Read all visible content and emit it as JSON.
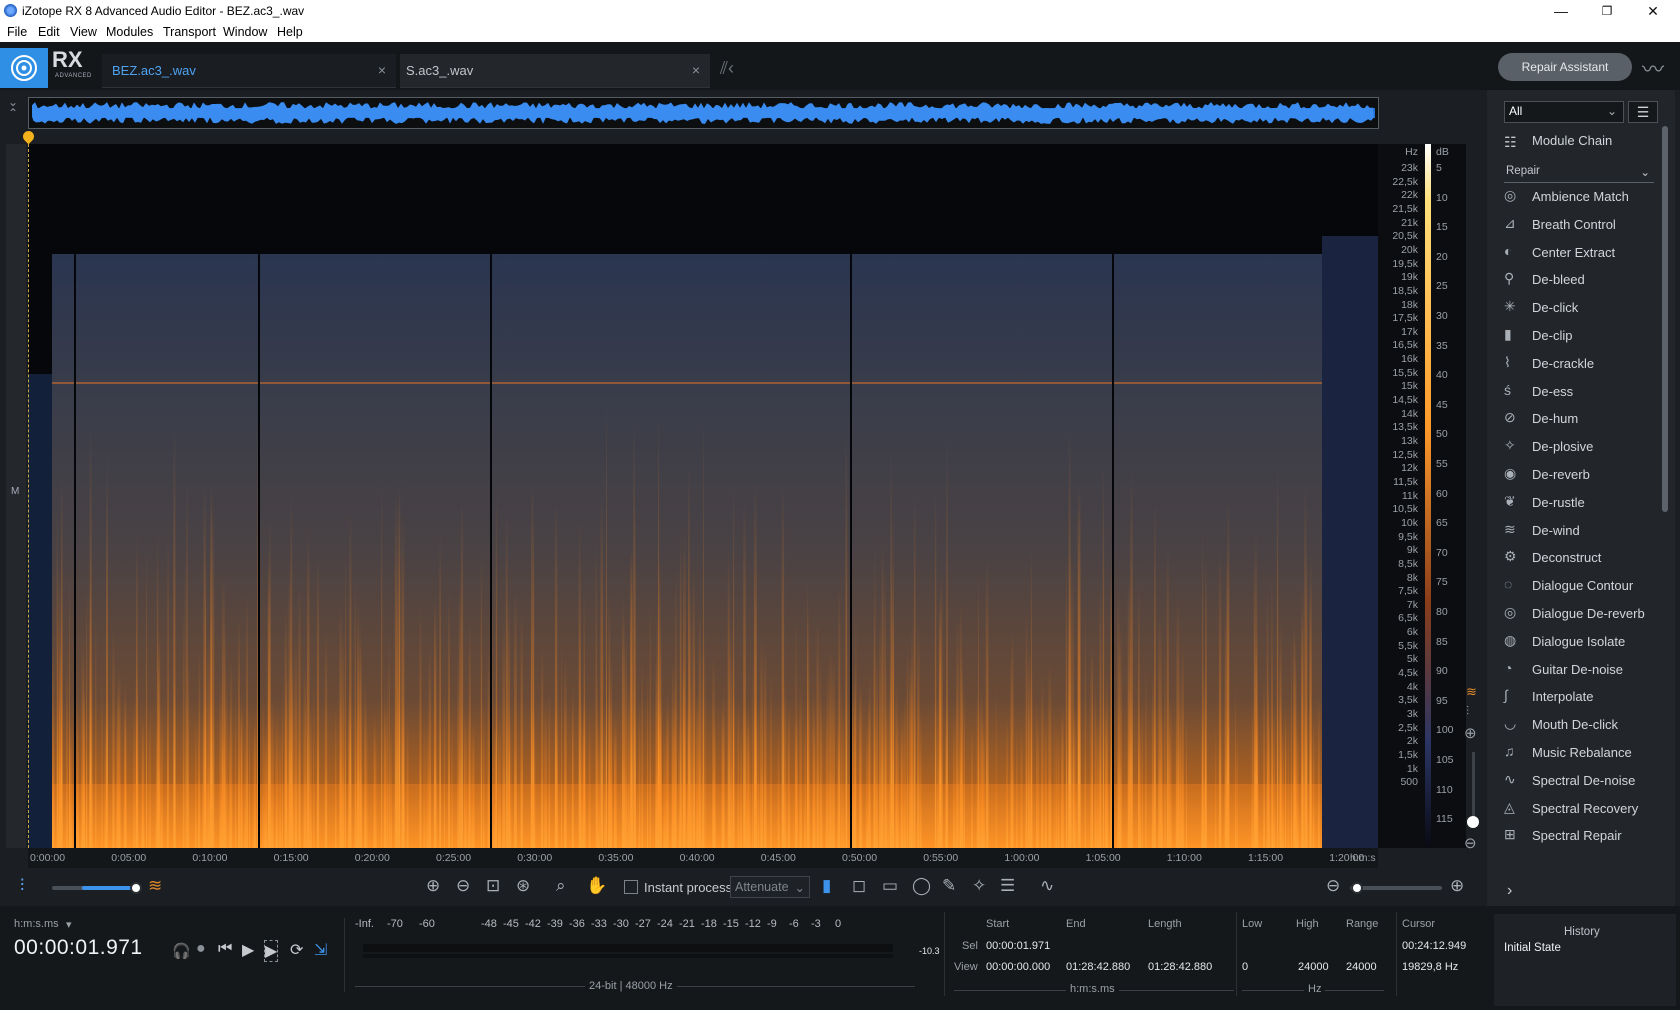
{
  "window": {
    "title": "iZotope RX 8 Advanced Audio Editor - BEZ.ac3_.wav",
    "minimize": "—",
    "maximize": "❐",
    "close": "✕"
  },
  "menu": [
    "File",
    "Edit",
    "View",
    "Modules",
    "Transport",
    "Window",
    "Help"
  ],
  "logo": {
    "text": "RX",
    "sub": "ADVANCED"
  },
  "tabs": [
    {
      "label": "BEZ.ac3_.wav",
      "active": true
    },
    {
      "label": "S.ac3_.wav",
      "active": false
    }
  ],
  "repair_assistant": "Repair Assistant",
  "spectrogram": {
    "freq_unit": "Hz",
    "db_unit": "dB",
    "freq_labels": [
      "23k",
      "22,5k",
      "22k",
      "21,5k",
      "21k",
      "20,5k",
      "20k",
      "19,5k",
      "19k",
      "18,5k",
      "18k",
      "17,5k",
      "17k",
      "16,5k",
      "16k",
      "15,5k",
      "15k",
      "14,5k",
      "14k",
      "13,5k",
      "13k",
      "12,5k",
      "12k",
      "11,5k",
      "11k",
      "10,5k",
      "10k",
      "9,5k",
      "9k",
      "8,5k",
      "8k",
      "7,5k",
      "7k",
      "6,5k",
      "6k",
      "5,5k",
      "5k",
      "4,5k",
      "4k",
      "3,5k",
      "3k",
      "2,5k",
      "2k",
      "1,5k",
      "1k",
      "500"
    ],
    "db_labels": [
      "5",
      "10",
      "15",
      "20",
      "25",
      "30",
      "35",
      "40",
      "45",
      "50",
      "55",
      "60",
      "65",
      "70",
      "75",
      "80",
      "85",
      "90",
      "95",
      "100",
      "105",
      "110",
      "115"
    ],
    "time_labels": [
      "0:00:00",
      "0:05:00",
      "0:10:00",
      "0:15:00",
      "0:20:00",
      "0:25:00",
      "0:30:00",
      "0:35:00",
      "0:40:00",
      "0:45:00",
      "0:50:00",
      "0:55:00",
      "1:00:00",
      "1:05:00",
      "1:10:00",
      "1:15:00",
      "1:20:00"
    ],
    "time_unit": "h:m:s",
    "channel": "M"
  },
  "toolbar": {
    "instant_process": "Instant process",
    "mode": "Attenuate"
  },
  "panel": {
    "filter": "All",
    "module_chain": "Module Chain",
    "category": "Repair",
    "modules": [
      "Ambience Match",
      "Breath Control",
      "Center Extract",
      "De-bleed",
      "De-click",
      "De-clip",
      "De-crackle",
      "De-ess",
      "De-hum",
      "De-plosive",
      "De-reverb",
      "De-rustle",
      "De-wind",
      "Deconstruct",
      "Dialogue Contour",
      "Dialogue De-reverb",
      "Dialogue Isolate",
      "Guitar De-noise",
      "Interpolate",
      "Mouth De-click",
      "Music Rebalance",
      "Spectral De-noise",
      "Spectral Recovery",
      "Spectral Repair"
    ]
  },
  "transport": {
    "time_format": "h:m:s.ms",
    "time": "00:00:01.971"
  },
  "meter": {
    "labels": [
      "-Inf.",
      "-70",
      "-60",
      "-48",
      "-45",
      "-42",
      "-39",
      "-36",
      "-33",
      "-30",
      "-27",
      "-24",
      "-21",
      "-18",
      "-15",
      "-12",
      "-9",
      "-6",
      "-3",
      "0"
    ],
    "peak": "-10.3",
    "format": "24-bit | 48000 Hz"
  },
  "selection": {
    "start_label": "Start",
    "end_label": "End",
    "length_label": "Length",
    "sel_label": "Sel",
    "view_label": "View",
    "sel_start": "00:00:01.971",
    "view_start": "00:00:00.000",
    "view_end": "01:28:42.880",
    "view_length": "01:28:42.880",
    "unit": "h:m:s.ms"
  },
  "freqsel": {
    "low_label": "Low",
    "high_label": "High",
    "range_label": "Range",
    "low": "0",
    "high": "24000",
    "range": "24000",
    "unit": "Hz"
  },
  "cursor": {
    "label": "Cursor",
    "time": "00:24:12.949",
    "freq": "19829,8 Hz"
  },
  "history": {
    "title": "History",
    "item": "Initial State"
  },
  "colors": {
    "accent": "#2f8fe4",
    "spectro_hot": "#ff8a1f",
    "spectro_cold": "#26345a"
  }
}
